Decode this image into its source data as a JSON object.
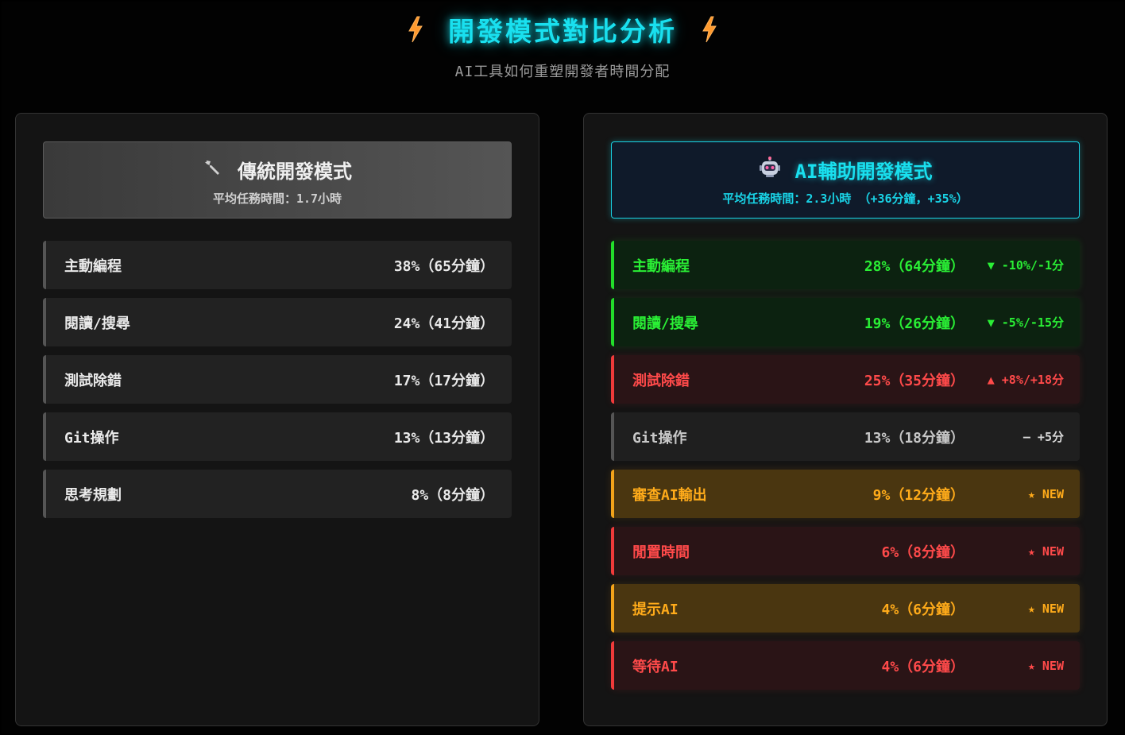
{
  "header": {
    "title": "開發模式對比分析",
    "subtitle": "AI工具如何重塑開發者時間分配",
    "icon": "lightning-bolt-icon"
  },
  "traditional": {
    "icon": "wrench-icon",
    "title": "傳統開發模式",
    "subtitle": "平均任務時間：1.7小時",
    "rows": [
      {
        "label": "主動編程",
        "value": "38%（65分鐘）"
      },
      {
        "label": "閱讀/搜尋",
        "value": "24%（41分鐘）"
      },
      {
        "label": "測試除錯",
        "value": "17%（17分鐘）"
      },
      {
        "label": "Git操作",
        "value": "13%（13分鐘）"
      },
      {
        "label": "思考規劃",
        "value": "8%（8分鐘）"
      }
    ]
  },
  "ai": {
    "icon": "robot-icon",
    "title": "AI輔助開發模式",
    "subtitle": "平均任務時間：2.3小時 （+36分鐘，+35%）",
    "rows": [
      {
        "label": "主動編程",
        "value": "28%（64分鐘）",
        "change": "▼ -10%/-1分",
        "status": "green"
      },
      {
        "label": "閱讀/搜尋",
        "value": "19%（26分鐘）",
        "change": "▼ -5%/-15分",
        "status": "green"
      },
      {
        "label": "測試除錯",
        "value": "25%（35分鐘）",
        "change": "▲ +8%/+18分",
        "status": "red"
      },
      {
        "label": "Git操作",
        "value": "13%（18分鐘）",
        "change": "— +5分",
        "status": "gray"
      },
      {
        "label": "審查AI輸出",
        "value": "9%（12分鐘）",
        "change": "★ NEW",
        "status": "orange"
      },
      {
        "label": "閒置時間",
        "value": "6%（8分鐘）",
        "change": "★ NEW",
        "status": "red"
      },
      {
        "label": "提示AI",
        "value": "4%（6分鐘）",
        "change": "★ NEW",
        "status": "orange"
      },
      {
        "label": "等待AI",
        "value": "4%（6分鐘）",
        "change": "★ NEW",
        "status": "red"
      }
    ]
  },
  "colors": {
    "accent": "#19e0ef",
    "decrease": "#2aef35",
    "increase": "#ff4a4a",
    "new": "#ffab1a",
    "bolt": "#ff9a2e"
  }
}
